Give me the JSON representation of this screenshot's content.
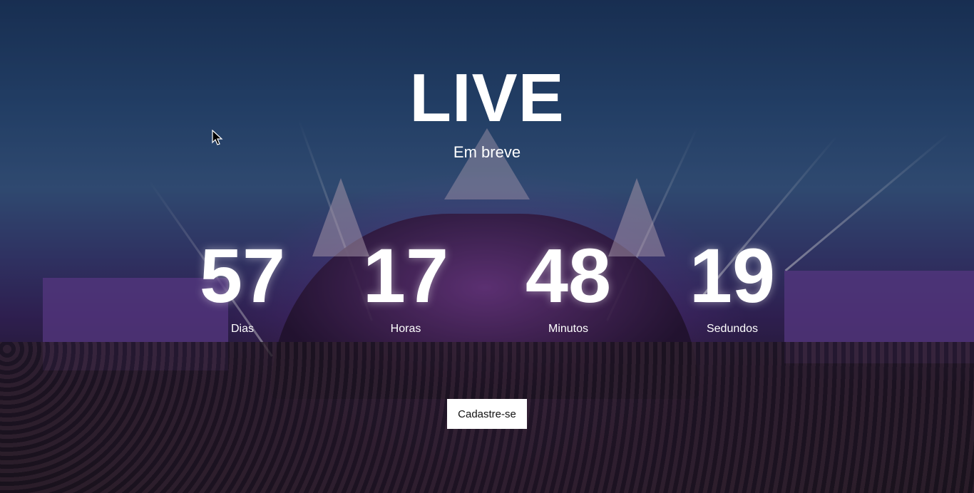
{
  "hero": {
    "title": "LIVE",
    "subtitle": "Em breve"
  },
  "countdown": [
    {
      "value": "57",
      "label": "Dias"
    },
    {
      "value": "17",
      "label": "Horas"
    },
    {
      "value": "48",
      "label": "Minutos"
    },
    {
      "value": "19",
      "label": "Sedundos"
    }
  ],
  "cta": {
    "label": "Cadastre-se"
  },
  "cursor_icon": "arrow-cursor-icon"
}
